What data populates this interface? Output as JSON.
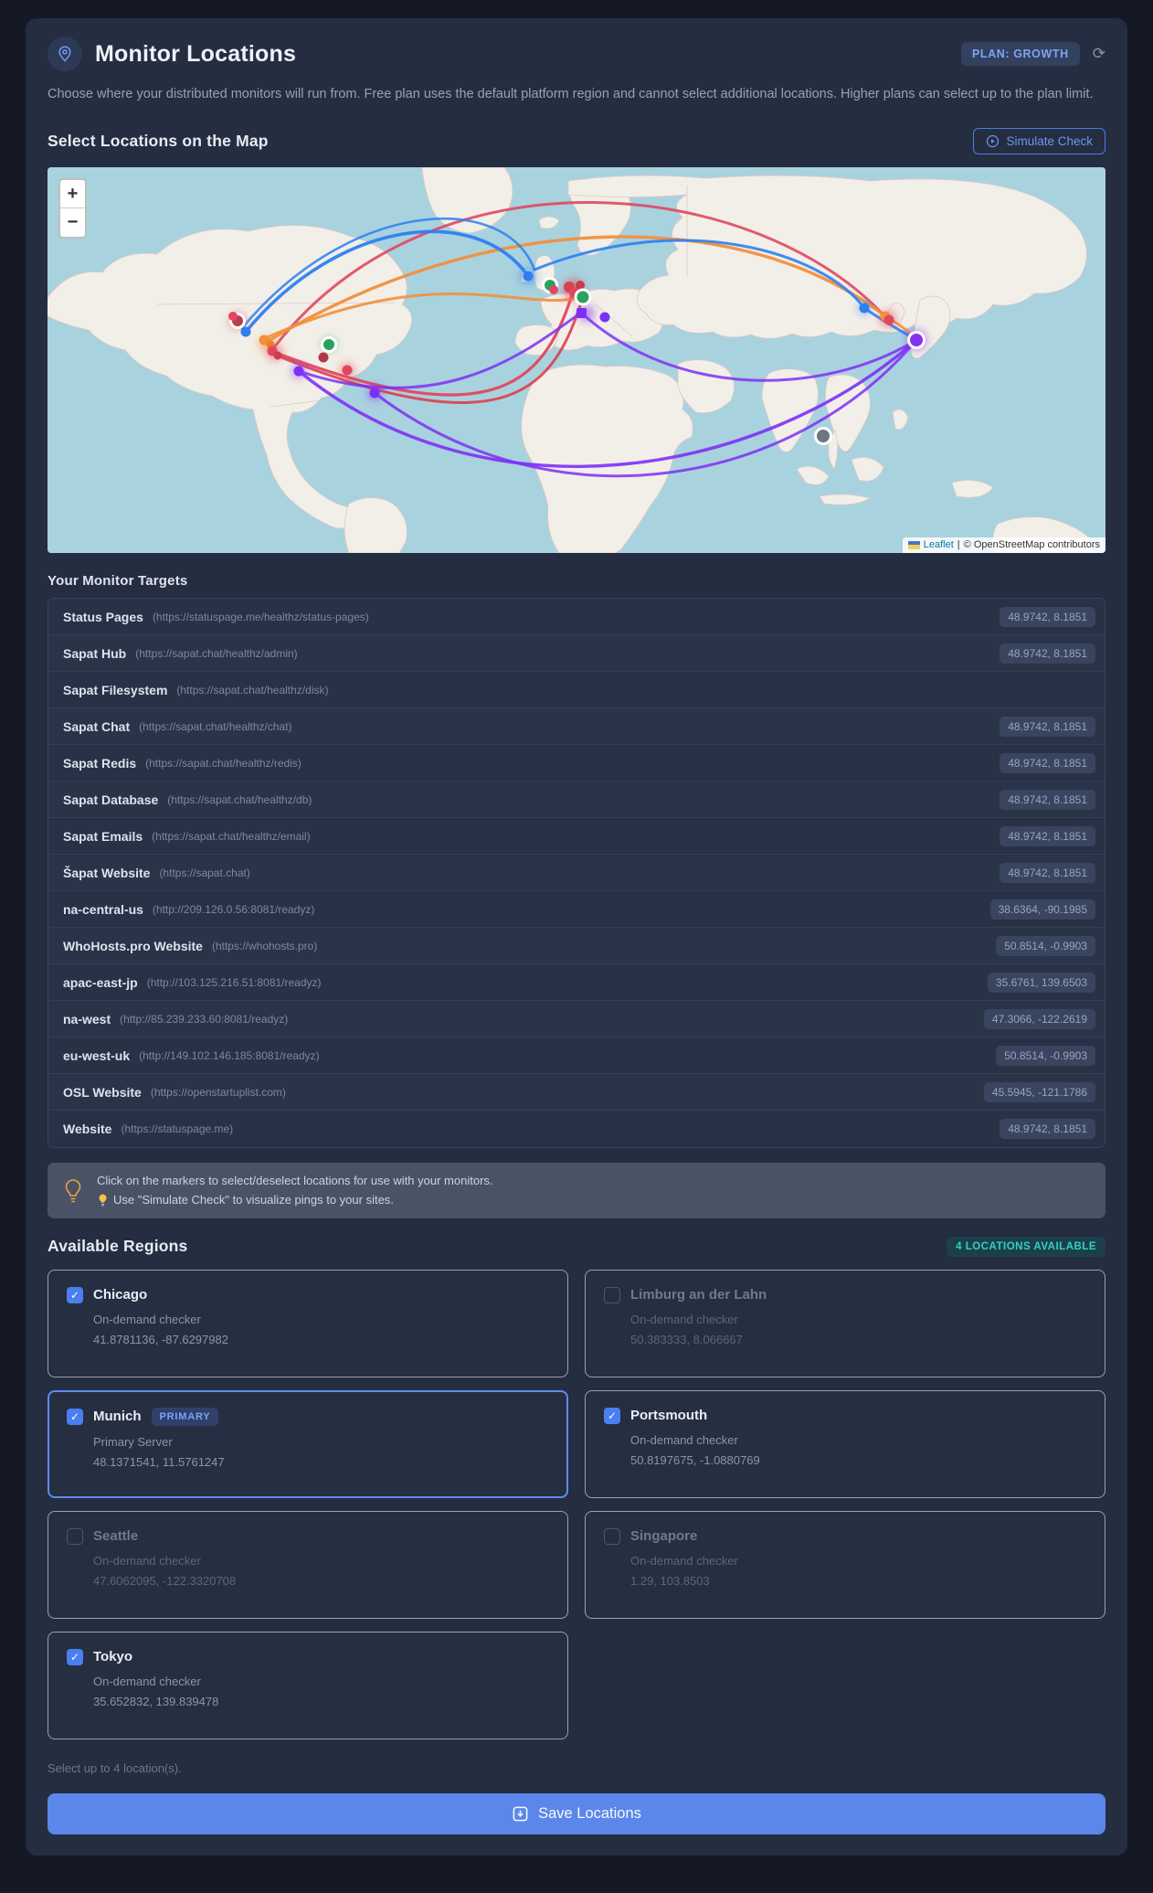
{
  "header": {
    "title": "Monitor Locations",
    "plan_badge": "PLAN: GROWTH",
    "refresh_icon": "⟳",
    "description": "Choose where your distributed monitors will run from. Free plan uses the default platform region and cannot select additional locations. Higher plans can select up to the plan limit."
  },
  "map_section": {
    "heading": "Select Locations on the Map",
    "simulate_button": "Simulate Check",
    "zoom_in": "+",
    "zoom_out": "−",
    "attribution": {
      "leaflet": "Leaflet",
      "separator": "|",
      "osm": "© OpenStreetMap contributors"
    },
    "line_colors": {
      "blue": "#2d7ff0",
      "orange": "#f28f3c",
      "red": "#e0475f",
      "purple": "#7d30f5"
    },
    "markers": [
      {
        "name": "seattle",
        "color": "gray-ring",
        "selected": false
      },
      {
        "name": "chicago",
        "color": "green-ring",
        "selected": true
      },
      {
        "name": "portsmouth",
        "color": "green-ring",
        "selected": true
      },
      {
        "name": "munich",
        "color": "green-ring",
        "selected": true
      },
      {
        "name": "tokyo",
        "color": "purple-ring",
        "selected": true
      },
      {
        "name": "singapore",
        "color": "gray-ring",
        "selected": false
      }
    ]
  },
  "targets": {
    "heading": "Your Monitor Targets",
    "rows": [
      {
        "name": "Status Pages",
        "url": "(https://statuspage.me/healthz/status-pages)",
        "coords": "48.9742, 8.1851"
      },
      {
        "name": "Sapat Hub",
        "url": "(https://sapat.chat/healthz/admin)",
        "coords": "48.9742, 8.1851"
      },
      {
        "name": "Sapat Filesystem",
        "url": "(https://sapat.chat/healthz/disk)",
        "coords": ""
      },
      {
        "name": "Sapat Chat",
        "url": "(https://sapat.chat/healthz/chat)",
        "coords": "48.9742, 8.1851"
      },
      {
        "name": "Sapat Redis",
        "url": "(https://sapat.chat/healthz/redis)",
        "coords": "48.9742, 8.1851"
      },
      {
        "name": "Sapat Database",
        "url": "(https://sapat.chat/healthz/db)",
        "coords": "48.9742, 8.1851"
      },
      {
        "name": "Sapat Emails",
        "url": "(https://sapat.chat/healthz/email)",
        "coords": "48.9742, 8.1851"
      },
      {
        "name": "Šapat Website",
        "url": "(https://sapat.chat)",
        "coords": "48.9742, 8.1851"
      },
      {
        "name": "na-central-us",
        "url": "(http://209.126.0.56:8081/readyz)",
        "coords": "38.6364, -90.1985"
      },
      {
        "name": "WhoHosts.pro Website",
        "url": "(https://whohosts.pro)",
        "coords": "50.8514, -0.9903"
      },
      {
        "name": "apac-east-jp",
        "url": "(http://103.125.216.51:8081/readyz)",
        "coords": "35.6761, 139.6503"
      },
      {
        "name": "na-west",
        "url": "(http://85.239.233.60:8081/readyz)",
        "coords": "47.3066, -122.2619"
      },
      {
        "name": "eu-west-uk",
        "url": "(http://149.102.146.185:8081/readyz)",
        "coords": "50.8514, -0.9903"
      },
      {
        "name": "OSL Website",
        "url": "(https://openstartuplist.com)",
        "coords": "45.5945, -121.1786"
      },
      {
        "name": "Website",
        "url": "(https://statuspage.me)",
        "coords": "48.9742, 8.1851"
      }
    ]
  },
  "tip": {
    "line1": "Click on the markers to select/deselect locations for use with your monitors.",
    "line2": "Use \"Simulate Check\" to visualize pings to your sites."
  },
  "regions": {
    "heading": "Available Regions",
    "badge": "4 LOCATIONS AVAILABLE",
    "note": "Select up to 4 location(s).",
    "cards": [
      {
        "name": "Chicago",
        "sub": "On-demand checker",
        "coords": "41.8781136, -87.6297982",
        "checked": true,
        "primary": false,
        "badge": ""
      },
      {
        "name": "Limburg an der Lahn",
        "sub": "On-demand checker",
        "coords": "50.383333, 8.066667",
        "checked": false,
        "primary": false,
        "badge": ""
      },
      {
        "name": "Munich",
        "sub": "Primary Server",
        "coords": "48.1371541, 11.5761247",
        "checked": true,
        "primary": true,
        "badge": "PRIMARY"
      },
      {
        "name": "Portsmouth",
        "sub": "On-demand checker",
        "coords": "50.8197675, -1.0880769",
        "checked": true,
        "primary": false,
        "badge": ""
      },
      {
        "name": "Seattle",
        "sub": "On-demand checker",
        "coords": "47.6062095, -122.3320708",
        "checked": false,
        "primary": false,
        "badge": ""
      },
      {
        "name": "Singapore",
        "sub": "On-demand checker",
        "coords": "1.29, 103.8503",
        "checked": false,
        "primary": false,
        "badge": ""
      },
      {
        "name": "Tokyo",
        "sub": "On-demand checker",
        "coords": "35.652832, 139.839478",
        "checked": true,
        "primary": false,
        "badge": ""
      }
    ]
  },
  "footer": {
    "save_label": "Save Locations"
  },
  "colors": {
    "accent": "#5b8def",
    "teal": "#31d0c5",
    "save": "#5b87ea",
    "ocean": "#a9d2df",
    "land": "#f2efe8"
  }
}
